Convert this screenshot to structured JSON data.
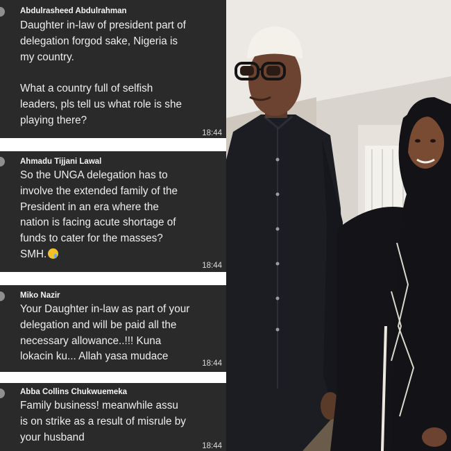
{
  "messages": [
    {
      "author": "Abdulrasheed Abdulrahman",
      "text": "Daughter in-law of president part of\ndelegation forgod sake, Nigeria is\nmy country.\n\nWhat a country full of selfish\nleaders, pls tell us what role is she\nplaying there?",
      "time": "18:44"
    },
    {
      "author": "Ahmadu Tijjani Lawal",
      "text": "So the UNGA delegation has to\ninvolve the extended family of the\nPresident in an era where the\nnation is facing acute shortage of\nfunds to cater for the masses?\nSMH.",
      "emoji": "laughing-crying-emoji",
      "time": "18:44"
    },
    {
      "author": "Miko Nazir",
      "text": "Your Daughter in-law as part of your\ndelegation and will be paid all the\nnecessary allowance..!!! Kuna\nlokacin ku... Allah yasa mudace",
      "time": "18:44"
    },
    {
      "author": "Abba Collins Chukwuemeka",
      "text": "Family business! meanwhile assu\nis on strike as a result of misrule by\nyour husband",
      "time": "18:44"
    }
  ],
  "colors": {
    "bubble": "#2a2a2a",
    "separator": "#ffffff",
    "text": "#eeeeee"
  },
  "photo": {
    "subject": "photo-of-two-people-standing-in-room"
  }
}
